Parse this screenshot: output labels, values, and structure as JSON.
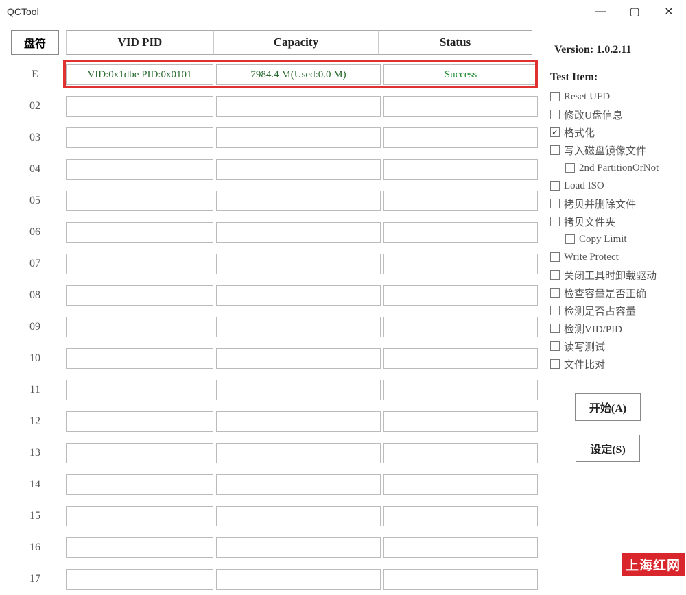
{
  "title": "QCTool",
  "version": "Version: 1.0.2.11",
  "headers": {
    "drive": "盘符",
    "vidpid": "VID PID",
    "capacity": "Capacity",
    "status": "Status"
  },
  "rows": [
    {
      "label": "E",
      "vidpid": "VID:0x1dbe PID:0x0101",
      "capacity": "7984.4 M(Used:0.0 M)",
      "status": "Success",
      "highlighted": true
    },
    {
      "label": "02",
      "vidpid": "",
      "capacity": "",
      "status": ""
    },
    {
      "label": "03",
      "vidpid": "",
      "capacity": "",
      "status": ""
    },
    {
      "label": "04",
      "vidpid": "",
      "capacity": "",
      "status": ""
    },
    {
      "label": "05",
      "vidpid": "",
      "capacity": "",
      "status": ""
    },
    {
      "label": "06",
      "vidpid": "",
      "capacity": "",
      "status": ""
    },
    {
      "label": "07",
      "vidpid": "",
      "capacity": "",
      "status": ""
    },
    {
      "label": "08",
      "vidpid": "",
      "capacity": "",
      "status": ""
    },
    {
      "label": "09",
      "vidpid": "",
      "capacity": "",
      "status": ""
    },
    {
      "label": "10",
      "vidpid": "",
      "capacity": "",
      "status": ""
    },
    {
      "label": "11",
      "vidpid": "",
      "capacity": "",
      "status": ""
    },
    {
      "label": "12",
      "vidpid": "",
      "capacity": "",
      "status": ""
    },
    {
      "label": "13",
      "vidpid": "",
      "capacity": "",
      "status": ""
    },
    {
      "label": "14",
      "vidpid": "",
      "capacity": "",
      "status": ""
    },
    {
      "label": "15",
      "vidpid": "",
      "capacity": "",
      "status": ""
    },
    {
      "label": "16",
      "vidpid": "",
      "capacity": "",
      "status": ""
    },
    {
      "label": "17",
      "vidpid": "",
      "capacity": "",
      "status": ""
    }
  ],
  "testItems": {
    "label": "Test Item:",
    "items": [
      {
        "label": "Reset UFD",
        "checked": false,
        "indent": false
      },
      {
        "label": "修改U盘信息",
        "checked": false,
        "indent": false
      },
      {
        "label": "格式化",
        "checked": true,
        "indent": false
      },
      {
        "label": "写入磁盘镜像文件",
        "checked": false,
        "indent": false
      },
      {
        "label": "2nd PartitionOrNot",
        "checked": false,
        "indent": true
      },
      {
        "label": "Load ISO",
        "checked": false,
        "indent": false
      },
      {
        "label": "拷贝并删除文件",
        "checked": false,
        "indent": false
      },
      {
        "label": "拷贝文件夹",
        "checked": false,
        "indent": false
      },
      {
        "label": "Copy Limit",
        "checked": false,
        "indent": true
      },
      {
        "label": "Write Protect",
        "checked": false,
        "indent": false
      },
      {
        "label": "关闭工具时卸载驱动",
        "checked": false,
        "indent": false
      },
      {
        "label": "检查容量是否正确",
        "checked": false,
        "indent": false
      },
      {
        "label": "检测是否占容量",
        "checked": false,
        "indent": false
      },
      {
        "label": "检测VID/PID",
        "checked": false,
        "indent": false
      },
      {
        "label": "读写测试",
        "checked": false,
        "indent": false
      },
      {
        "label": "文件比对",
        "checked": false,
        "indent": false
      }
    ]
  },
  "buttons": {
    "start": "开始(A)",
    "settings": "设定(S)"
  },
  "watermark": "上海红网"
}
